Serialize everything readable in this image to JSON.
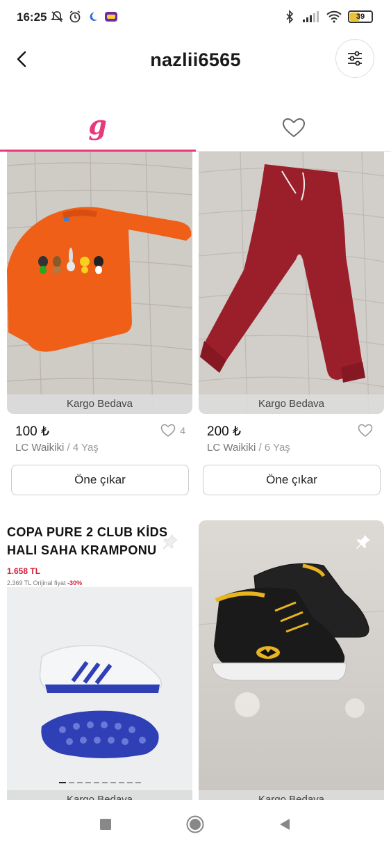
{
  "status_bar": {
    "time": "16:25",
    "battery": "39",
    "icons_left": [
      "mute-icon",
      "alarm-icon",
      "moon-icon",
      "app-notification-icon"
    ],
    "icons_right": [
      "bluetooth-icon",
      "signal-icon",
      "wifi-icon",
      "battery-icon"
    ]
  },
  "header": {
    "title": "nazlii6565",
    "back_icon": "back-arrow-icon",
    "filter_icon": "filter-sliders-icon"
  },
  "tabs": {
    "listings_icon": "g",
    "favorites_icon": "heart-icon",
    "active": "listings"
  },
  "listings": [
    {
      "shipping": "Kargo Bedava",
      "price": "100 ₺",
      "brand": "LC Waikiki",
      "separator": "/",
      "size": "4 Yaş",
      "likes": "4",
      "promote_label": "Öne çıkar",
      "image": "orange kids sweatshirt"
    },
    {
      "shipping": "Kargo Bedava",
      "price": "200 ₺",
      "brand": "LC Waikiki",
      "separator": "/",
      "size": "6 Yaş",
      "likes": "",
      "promote_label": "Öne çıkar",
      "image": "burgundy jogger pants"
    },
    {
      "shipping": "Kargo Bedava",
      "ad_title_line1": "COPA PURE 2 CLUB KİDS",
      "ad_title_line2": "HALI SAHA KRAMPONU",
      "ad_price": "1.658 TL",
      "ad_original": "2.369 TL Orijinal fiyat",
      "ad_discount": "-30%",
      "image": "white blue football boots"
    },
    {
      "shipping": "Kargo Bedava",
      "image": "black batman sneakers"
    }
  ],
  "nav": {
    "recents_icon": "square-icon",
    "home_icon": "circle-icon",
    "back_icon": "triangle-back-icon"
  },
  "colors": {
    "accent": "#e7397c",
    "price_red": "#d21f3c"
  }
}
